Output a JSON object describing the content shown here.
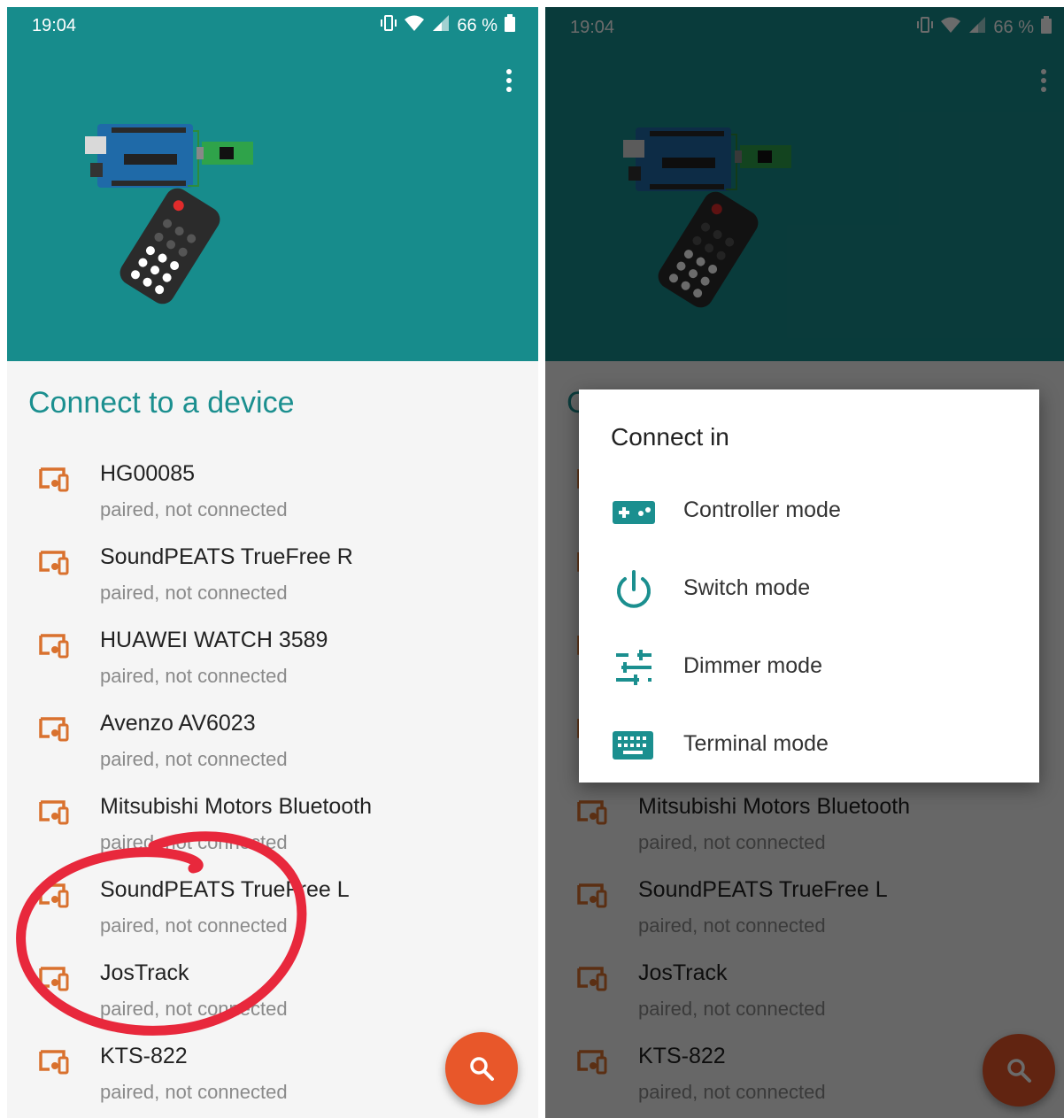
{
  "status_bar": {
    "time": "19:04",
    "battery": "66 %",
    "icons": [
      "whatsapp-icon",
      "vibrate-icon",
      "wifi-icon",
      "signal-icon",
      "battery-icon"
    ]
  },
  "screen": {
    "title": "Connect to a device",
    "device_icon": "bluetooth-devices-icon",
    "devices": [
      {
        "name": "HG00085",
        "status": "paired, not connected"
      },
      {
        "name": "SoundPEATS TrueFree R",
        "status": "paired, not connected"
      },
      {
        "name": "HUAWEI WATCH 3589",
        "status": "paired, not connected"
      },
      {
        "name": "Avenzo AV6023",
        "status": "paired, not connected"
      },
      {
        "name": "Mitsubishi Motors Bluetooth",
        "status": "paired, not connected"
      },
      {
        "name": "SoundPEATS TrueFree L",
        "status": "paired, not connected"
      },
      {
        "name": "JosTrack",
        "status": "paired, not connected"
      },
      {
        "name": "KTS-822",
        "status": "paired, not connected"
      }
    ],
    "fab_icon": "search-icon"
  },
  "dialog": {
    "title": "Connect in",
    "options": [
      {
        "label": "Controller mode",
        "icon": "gamepad-icon"
      },
      {
        "label": "Switch mode",
        "icon": "power-icon"
      },
      {
        "label": "Dimmer mode",
        "icon": "tune-sliders-icon"
      },
      {
        "label": "Terminal mode",
        "icon": "keyboard-icon"
      }
    ]
  },
  "colors": {
    "header": "#178c8c",
    "header_dimmed": "#0b3838",
    "accent": "#1b8f8f",
    "fab": "#e8572a",
    "device_icon": "#d9712e",
    "annotation": "#e8283c"
  }
}
